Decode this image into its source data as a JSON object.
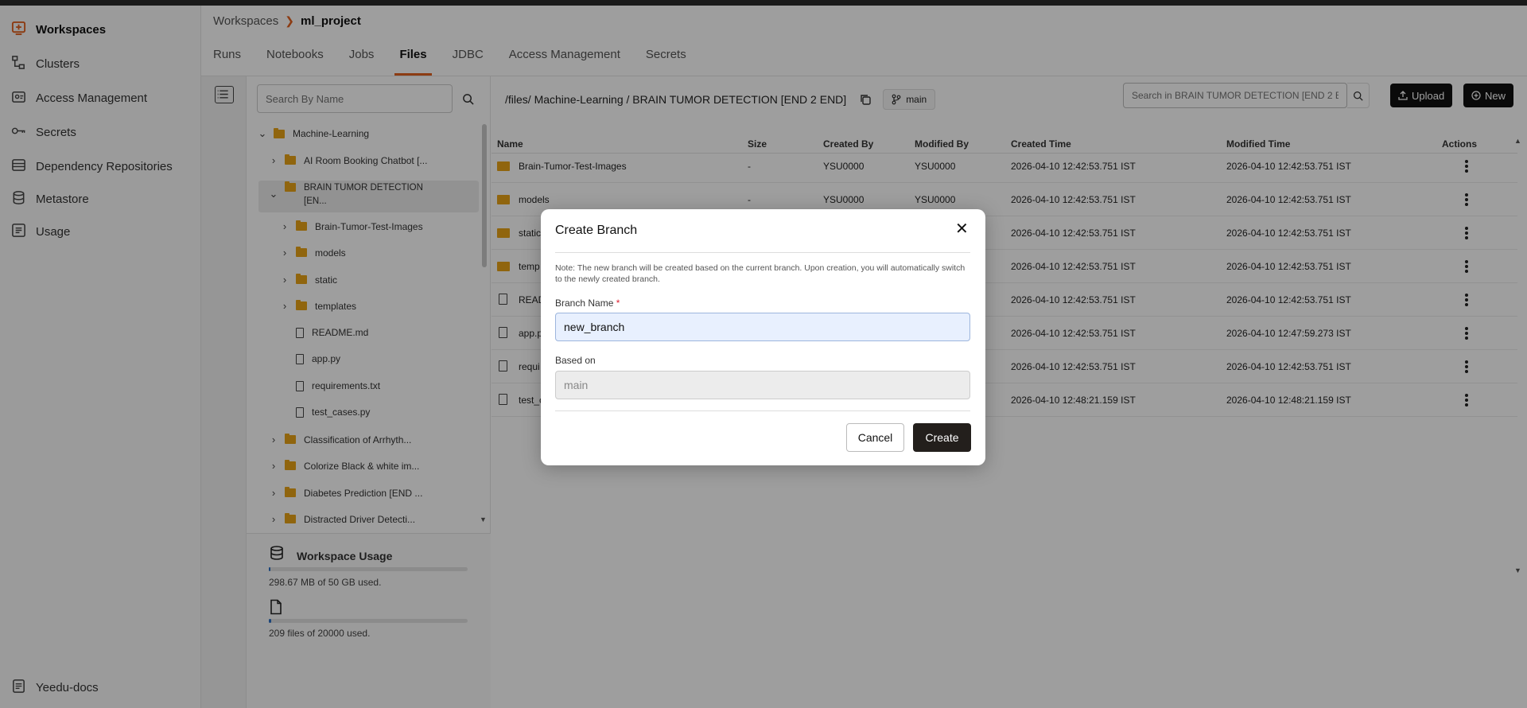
{
  "sidebar": {
    "items": [
      {
        "label": "Workspaces",
        "icon": "workspaces-icon",
        "active": true
      },
      {
        "label": "Clusters",
        "icon": "clusters-icon"
      },
      {
        "label": "Access Management",
        "icon": "access-management-icon"
      },
      {
        "label": "Secrets",
        "icon": "key-icon"
      },
      {
        "label": "Dependency Repositories",
        "icon": "repository-icon"
      },
      {
        "label": "Metastore",
        "icon": "database-icon"
      },
      {
        "label": "Usage",
        "icon": "usage-icon"
      }
    ],
    "footer": {
      "label": "Yeedu-docs",
      "icon": "docs-icon"
    }
  },
  "breadcrumb": {
    "parent": "Workspaces",
    "current": "ml_project"
  },
  "tabs": [
    "Runs",
    "Notebooks",
    "Jobs",
    "Files",
    "JDBC",
    "Access Management",
    "Secrets"
  ],
  "active_tab": "Files",
  "tree": {
    "search_placeholder": "Search By Name",
    "root": "Machine-Learning",
    "items": [
      {
        "label": "AI Room Booking Chatbot [...",
        "type": "folder",
        "level": 1
      },
      {
        "label": "BRAIN TUMOR DETECTION",
        "label2": "[EN...",
        "type": "folder",
        "level": 1,
        "expanded": true,
        "selected": true
      },
      {
        "label": "Brain-Tumor-Test-Images",
        "type": "folder",
        "level": 2
      },
      {
        "label": "models",
        "type": "folder",
        "level": 2
      },
      {
        "label": "static",
        "type": "folder",
        "level": 2
      },
      {
        "label": "templates",
        "type": "folder",
        "level": 2
      },
      {
        "label": "README.md",
        "type": "file",
        "level": 2
      },
      {
        "label": "app.py",
        "type": "file",
        "level": 2
      },
      {
        "label": "requirements.txt",
        "type": "file",
        "level": 2
      },
      {
        "label": "test_cases.py",
        "type": "file",
        "level": 2
      },
      {
        "label": "Classification of Arrhyth...",
        "type": "folder",
        "level": 1
      },
      {
        "label": "Colorize Black & white im...",
        "type": "folder",
        "level": 1
      },
      {
        "label": "Diabetes Prediction [END ...",
        "type": "folder",
        "level": 1
      },
      {
        "label": "Distracted Driver Detecti...",
        "type": "folder",
        "level": 1
      }
    ]
  },
  "usage": {
    "title": "Workspace Usage",
    "storage_text": "298.67 MB of 50 GB used.",
    "storage_fraction": 0.006,
    "files_text": "209 files of 20000 used.",
    "files_fraction": 0.011
  },
  "path": {
    "text": "/files/ Machine-Learning / BRAIN TUMOR DETECTION [END 2 END]",
    "branch": "main"
  },
  "main_search": {
    "placeholder": "Search in BRAIN TUMOR DETECTION [END 2 END]"
  },
  "buttons": {
    "upload": "Upload",
    "new": "New"
  },
  "table": {
    "headers": [
      "Name",
      "Size",
      "Created By",
      "Modified By",
      "Created Time",
      "Modified Time",
      "Actions"
    ],
    "rows": [
      {
        "name": "Brain-Tumor-Test-Images",
        "type": "folder",
        "size": "-",
        "created_by": "YSU0000",
        "modified_by": "YSU0000",
        "created": "2026-04-10 12:42:53.751 IST",
        "modified": "2026-04-10 12:42:53.751 IST"
      },
      {
        "name": "models",
        "type": "folder",
        "size": "-",
        "created_by": "YSU0000",
        "modified_by": "YSU0000",
        "created": "2026-04-10 12:42:53.751 IST",
        "modified": "2026-04-10 12:42:53.751 IST"
      },
      {
        "name": "static",
        "type": "folder",
        "size": "",
        "created_by": "",
        "modified_by": "",
        "created": "2026-04-10 12:42:53.751 IST",
        "modified": "2026-04-10 12:42:53.751 IST"
      },
      {
        "name": "temp",
        "type": "folder",
        "size": "",
        "created_by": "",
        "modified_by": "",
        "created": "2026-04-10 12:42:53.751 IST",
        "modified": "2026-04-10 12:42:53.751 IST"
      },
      {
        "name": "READ",
        "type": "file",
        "size": "",
        "created_by": "",
        "modified_by": "",
        "created": "2026-04-10 12:42:53.751 IST",
        "modified": "2026-04-10 12:42:53.751 IST"
      },
      {
        "name": "app.p",
        "type": "file",
        "size": "",
        "created_by": "",
        "modified_by": "",
        "created": "2026-04-10 12:42:53.751 IST",
        "modified": "2026-04-10 12:47:59.273 IST"
      },
      {
        "name": "requi",
        "type": "file",
        "size": "",
        "created_by": "",
        "modified_by": "",
        "created": "2026-04-10 12:42:53.751 IST",
        "modified": "2026-04-10 12:42:53.751 IST"
      },
      {
        "name": "test_c",
        "type": "file",
        "size": "",
        "created_by": "",
        "modified_by": "",
        "created": "2026-04-10 12:48:21.159 IST",
        "modified": "2026-04-10 12:48:21.159 IST"
      }
    ]
  },
  "modal": {
    "title": "Create Branch",
    "note": "Note: The new branch will be created based on the current branch. Upon creation, you will automatically switch to the newly created branch.",
    "branch_label": "Branch Name",
    "required_mark": "*",
    "branch_value": "new_branch",
    "based_on_label": "Based on",
    "based_on_value": "main",
    "cancel": "Cancel",
    "create": "Create"
  },
  "colors": {
    "accent": "#e2611f",
    "folder": "#e8a317",
    "dark_button": "#111111",
    "progress": "#2c6fc4"
  }
}
